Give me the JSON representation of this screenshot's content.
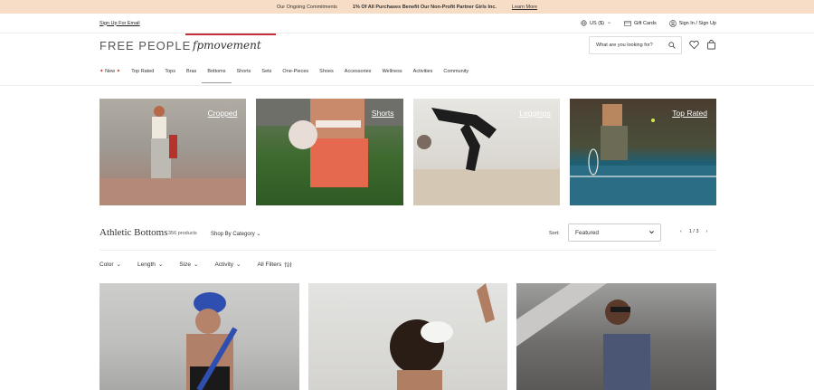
{
  "promo": {
    "item1": "Our Ongoing Commitments",
    "item2": "1% Of All Purchases Benefit Our Non-Profit Partner Girls Inc.",
    "link": "Learn More"
  },
  "utility": {
    "signup": "Sign Up For Email",
    "region": "US ($)",
    "gift_cards": "Gift Cards",
    "sign_in": "Sign In / Sign Up"
  },
  "brand": {
    "logo": "FREE PEOPLE",
    "movement": "fpmovement"
  },
  "search": {
    "placeholder": "What are you looking for?"
  },
  "nav": {
    "items": [
      "New",
      "Top Rated",
      "Tops",
      "Bras",
      "Bottoms",
      "Shorts",
      "Sets",
      "One-Pieces",
      "Shoes",
      "Accessories",
      "Wellness",
      "Activities",
      "Community"
    ]
  },
  "categories": [
    "Cropped",
    "Shorts",
    "Leggings",
    "Top Rated"
  ],
  "listing": {
    "title": "Athletic Bottoms",
    "count": "356 products",
    "shop_by": "Shop By Category",
    "sort_label": "Sort:",
    "sort_value": "Featured",
    "page": "1 / 3"
  },
  "filters": [
    "Color",
    "Length",
    "Size",
    "Activity",
    "All Filters"
  ],
  "colors": {
    "accent": "#c62d3a",
    "promo_bg": "#f7dcc6"
  }
}
